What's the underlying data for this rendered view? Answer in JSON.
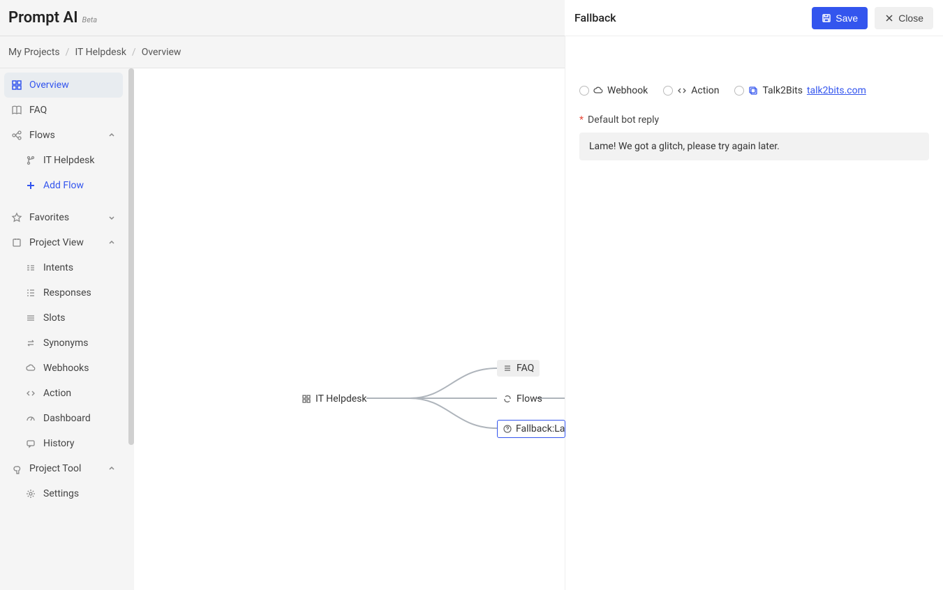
{
  "app": {
    "name": "Prompt AI",
    "badge": "Beta"
  },
  "breadcrumb": {
    "root": "My Projects",
    "project": "IT Helpdesk",
    "page": "Overview"
  },
  "sidebar": {
    "overview": "Overview",
    "faq": "FAQ",
    "flows": {
      "label": "Flows",
      "items": [
        "IT Helpdesk"
      ],
      "add": "Add Flow"
    },
    "favorites": "Favorites",
    "project_view": {
      "label": "Project View",
      "items": [
        "Intents",
        "Responses",
        "Slots",
        "Synonyms",
        "Webhooks",
        "Action",
        "Dashboard",
        "History"
      ]
    },
    "project_tool": {
      "label": "Project Tool",
      "items": [
        "Settings"
      ]
    }
  },
  "canvas": {
    "root": "IT Helpdesk",
    "faq": "FAQ",
    "flows": "Flows",
    "fallback": "Fallback:Lame! We got a glitch, please try again later."
  },
  "panel": {
    "title": "Fallback",
    "save": "Save",
    "close": "Close",
    "options": {
      "webhook": "Webhook",
      "action": "Action",
      "talk2bits": "Talk2Bits",
      "talk2bits_link": "talk2bits.com"
    },
    "field_label": "Default bot reply",
    "field_value": "Lame! We got a glitch, please try again later."
  }
}
